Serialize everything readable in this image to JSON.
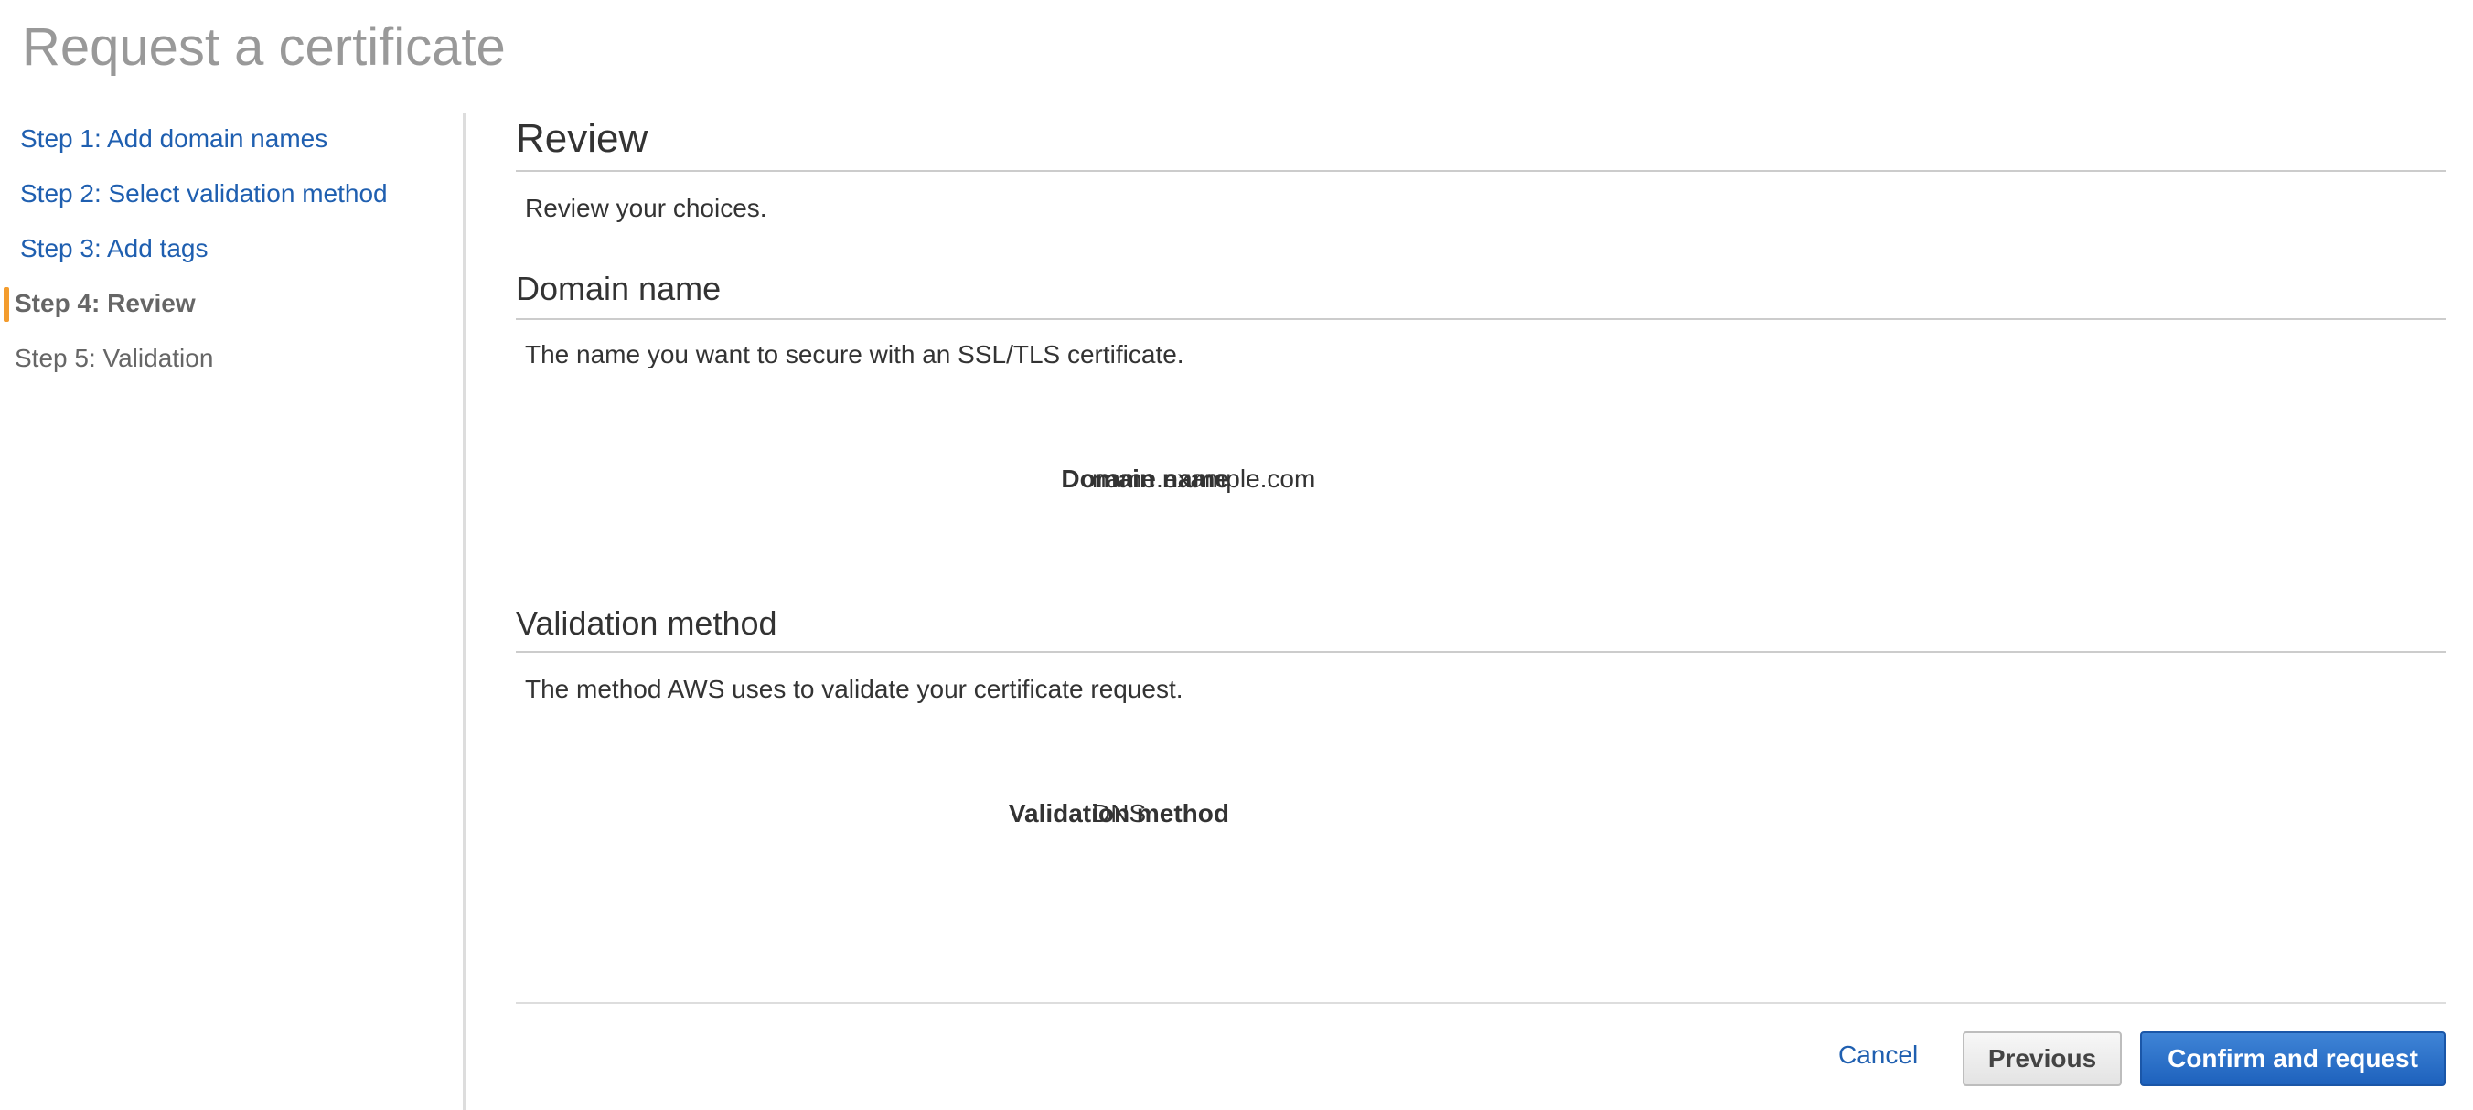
{
  "page": {
    "title": "Request a certificate"
  },
  "sidebar": {
    "steps": [
      {
        "label": "Step 1: Add domain names",
        "state": "completed"
      },
      {
        "label": "Step 2: Select validation method",
        "state": "completed"
      },
      {
        "label": "Step 3: Add tags",
        "state": "completed"
      },
      {
        "label": "Step 4: Review",
        "state": "current"
      },
      {
        "label": "Step 5: Validation",
        "state": "upcoming"
      }
    ],
    "active_indicator_color": "#f39c2e"
  },
  "main": {
    "review": {
      "heading": "Review",
      "description": "Review your choices."
    },
    "domain_section": {
      "heading": "Domain name",
      "description": "The name you want to secure with an SSL/TLS certificate.",
      "field_label": "Domain name",
      "field_value": "name.example.com"
    },
    "validation_section": {
      "heading": "Validation method",
      "description": "The method AWS uses to validate your certificate request.",
      "field_label": "Validation method",
      "field_value": "DNS"
    }
  },
  "footer": {
    "cancel_label": "Cancel",
    "previous_label": "Previous",
    "confirm_label": "Confirm and request"
  },
  "colors": {
    "link": "#1f5fb0",
    "primary_button": "#1e62bd",
    "title_gray": "#999999"
  }
}
